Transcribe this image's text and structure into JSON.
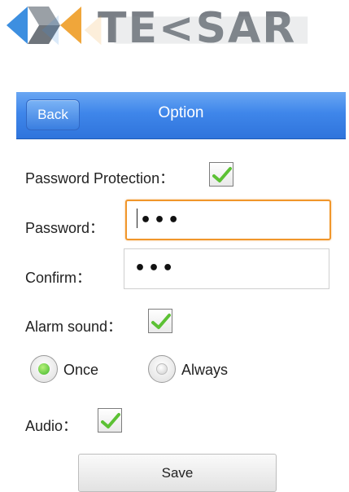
{
  "logo": {
    "text": "TE<SAR"
  },
  "header": {
    "back_label": "Back",
    "title": "Option"
  },
  "form": {
    "password_protection": {
      "label": "Password Protection：",
      "checked": true
    },
    "password": {
      "label": "Password：",
      "value": "•••"
    },
    "confirm": {
      "label": "Confirm：",
      "value": "•••"
    },
    "alarm_sound": {
      "label": "Alarm sound：",
      "checked": true
    },
    "alarm_mode": {
      "options": [
        {
          "label": "Once",
          "selected": true
        },
        {
          "label": "Always",
          "selected": false
        }
      ]
    },
    "audio": {
      "label": "Audio：",
      "checked": true
    }
  },
  "save_label": "Save",
  "colors": {
    "header_blue": "#3f86ea",
    "check_green": "#5cc134",
    "focus_orange": "#f0962b"
  }
}
